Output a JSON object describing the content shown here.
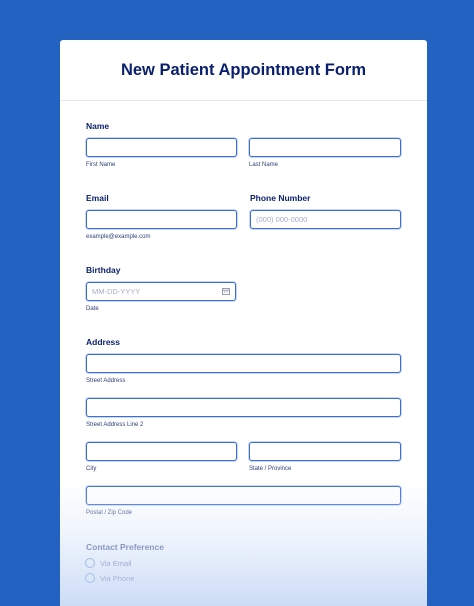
{
  "form": {
    "title": "New Patient Appointment Form",
    "name": {
      "label": "Name",
      "first_sublabel": "First Name",
      "last_sublabel": "Last Name"
    },
    "email": {
      "label": "Email",
      "sublabel": "example@example.com"
    },
    "phone": {
      "label": "Phone Number",
      "placeholder": "(000) 000-0000"
    },
    "birthday": {
      "label": "Birthday",
      "placeholder": "MM-DD-YYYY",
      "sublabel": "Date",
      "icon": "calendar-icon"
    },
    "address": {
      "label": "Address",
      "street_sublabel": "Street Address",
      "street2_sublabel": "Street Address Line 2",
      "city_sublabel": "City",
      "state_sublabel": "State / Province",
      "zip_sublabel": "Postal / Zip Code"
    },
    "contact_preference": {
      "label": "Contact Preference",
      "options": [
        "Via Email",
        "Via Phone"
      ]
    }
  },
  "colors": {
    "background": "#2462c2",
    "title": "#0a1f6e",
    "input_border": "#3b6ed0"
  }
}
